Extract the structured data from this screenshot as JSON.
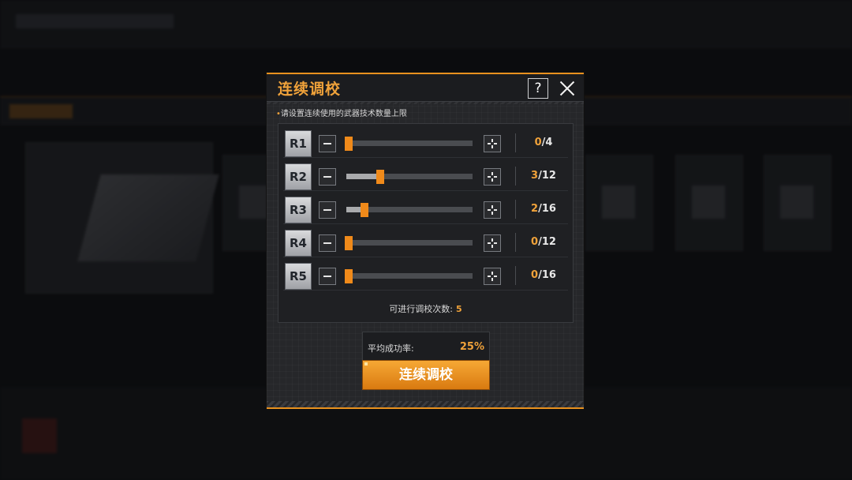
{
  "dialog": {
    "title": "连续调校",
    "help_label": "?",
    "hint": "请设置连续使用的武器技术数量上限",
    "remaining_label": "可进行调校次数:",
    "remaining_value": "5",
    "success_rate_label": "平均成功率:",
    "success_rate_value": "25%",
    "action_label": "连续调校"
  },
  "rows": [
    {
      "label": "R1",
      "current": "0",
      "max": "/4",
      "fraction": 0
    },
    {
      "label": "R2",
      "current": "3",
      "max": "/12",
      "fraction": 0.25
    },
    {
      "label": "R3",
      "current": "2",
      "max": "/16",
      "fraction": 0.125
    },
    {
      "label": "R4",
      "current": "0",
      "max": "/12",
      "fraction": 0
    },
    {
      "label": "R5",
      "current": "0",
      "max": "/16",
      "fraction": 0
    }
  ],
  "colors": {
    "accent": "#f0a23a",
    "button": "#e8911e",
    "panel": "#26272a"
  },
  "icons": {
    "help": "question-icon",
    "close": "close-icon",
    "minus": "minus-icon",
    "plus": "plus-icon"
  }
}
